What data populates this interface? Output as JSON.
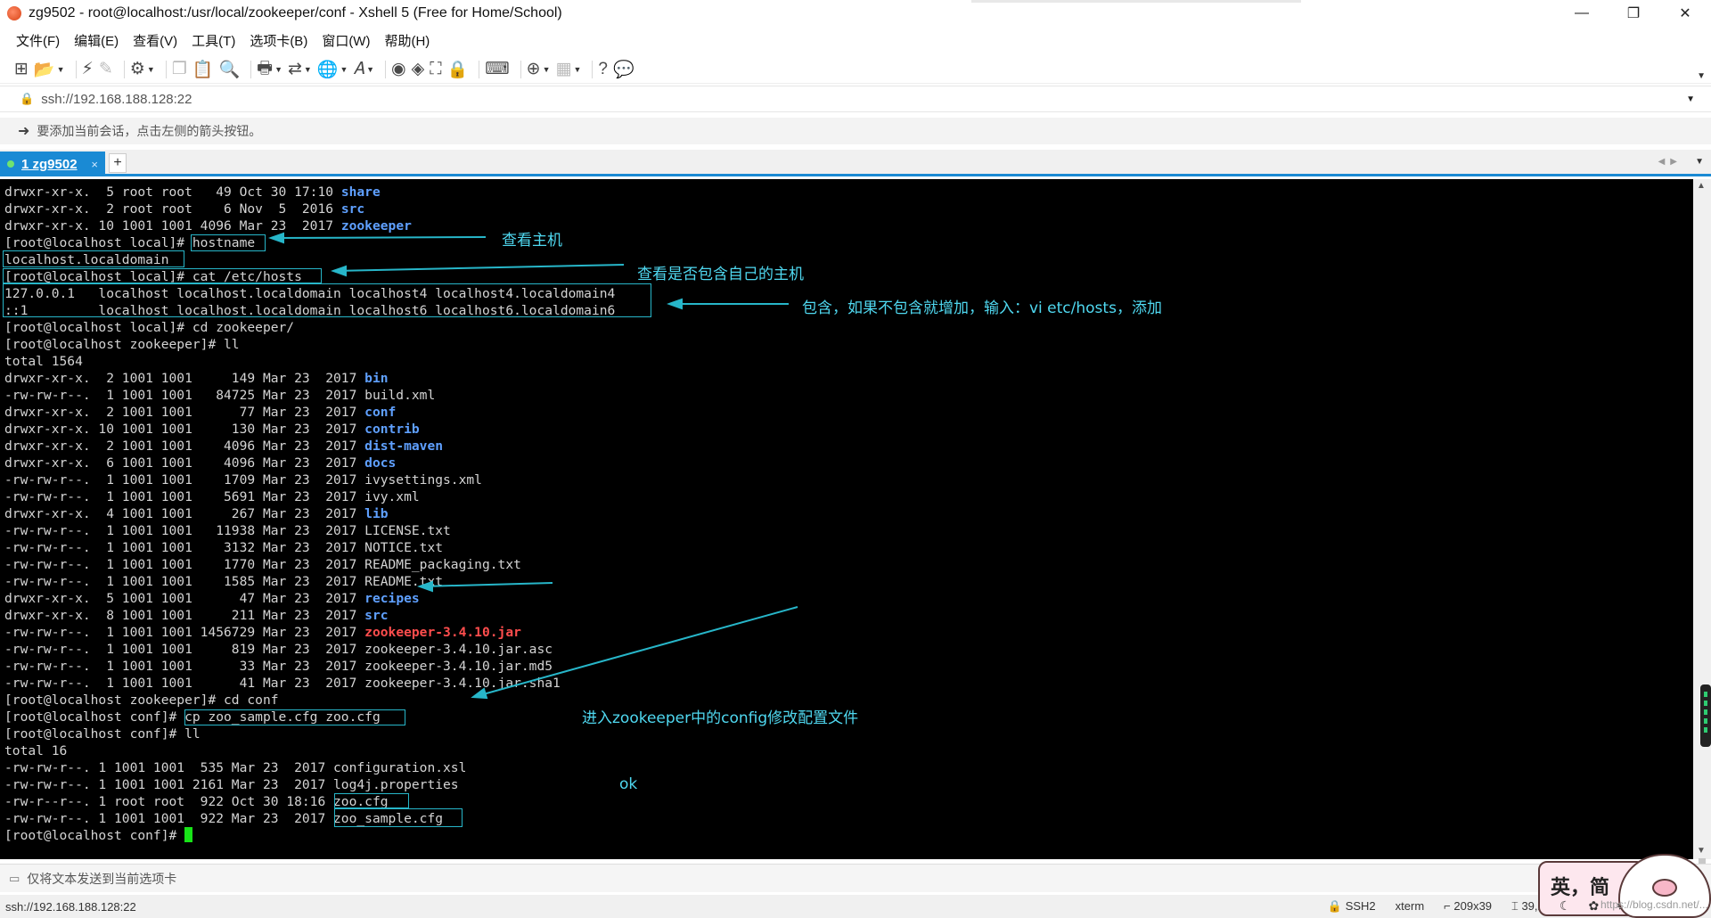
{
  "window": {
    "title": "zg9502 - root@localhost:/usr/local/zookeeper/conf - Xshell 5 (Free for Home/School)",
    "controls": [
      "—",
      "❐",
      "✕"
    ]
  },
  "menu": [
    "文件(F)",
    "编辑(E)",
    "查看(V)",
    "工具(T)",
    "选项卡(B)",
    "窗口(W)",
    "帮助(H)"
  ],
  "address": {
    "value": "ssh://192.168.188.128:22"
  },
  "hint": "要添加当前会话，点击左侧的箭头按钮。",
  "tab": {
    "label": "1 zg9502",
    "close": "×",
    "add": "+"
  },
  "terminal": {
    "lines": [
      [
        {
          "t": "drwxr-xr-x.  5 root root   49 Oct 30 17:10 "
        },
        {
          "t": "share",
          "c": "dir"
        }
      ],
      [
        {
          "t": "drwxr-xr-x.  2 root root    6 Nov  5  2016 "
        },
        {
          "t": "src",
          "c": "dir"
        }
      ],
      [
        {
          "t": "drwxr-xr-x. 10 1001 1001 4096 Mar 23  2017 "
        },
        {
          "t": "zookeeper",
          "c": "dir"
        }
      ],
      [
        {
          "t": "[root@localhost local]# hostname"
        }
      ],
      [
        {
          "t": "localhost.localdomain"
        }
      ],
      [
        {
          "t": "[root@localhost local]# cat /etc/hosts"
        }
      ],
      [
        {
          "t": "127.0.0.1   localhost localhost.localdomain localhost4 localhost4.localdomain4"
        }
      ],
      [
        {
          "t": "::1         localhost localhost.localdomain localhost6 localhost6.localdomain6"
        }
      ],
      [
        {
          "t": "[root@localhost local]# cd zookeeper/"
        }
      ],
      [
        {
          "t": "[root@localhost zookeeper]# ll"
        }
      ],
      [
        {
          "t": "total 1564"
        }
      ],
      [
        {
          "t": "drwxr-xr-x.  2 1001 1001     149 Mar 23  2017 "
        },
        {
          "t": "bin",
          "c": "dir"
        }
      ],
      [
        {
          "t": "-rw-rw-r--.  1 1001 1001   84725 Mar 23  2017 build.xml"
        }
      ],
      [
        {
          "t": "drwxr-xr-x.  2 1001 1001      77 Mar 23  2017 "
        },
        {
          "t": "conf",
          "c": "dir"
        }
      ],
      [
        {
          "t": "drwxr-xr-x. 10 1001 1001     130 Mar 23  2017 "
        },
        {
          "t": "contrib",
          "c": "dir"
        }
      ],
      [
        {
          "t": "drwxr-xr-x.  2 1001 1001    4096 Mar 23  2017 "
        },
        {
          "t": "dist-maven",
          "c": "dir"
        }
      ],
      [
        {
          "t": "drwxr-xr-x.  6 1001 1001    4096 Mar 23  2017 "
        },
        {
          "t": "docs",
          "c": "dir"
        }
      ],
      [
        {
          "t": "-rw-rw-r--.  1 1001 1001    1709 Mar 23  2017 ivysettings.xml"
        }
      ],
      [
        {
          "t": "-rw-rw-r--.  1 1001 1001    5691 Mar 23  2017 ivy.xml"
        }
      ],
      [
        {
          "t": "drwxr-xr-x.  4 1001 1001     267 Mar 23  2017 "
        },
        {
          "t": "lib",
          "c": "dir"
        }
      ],
      [
        {
          "t": "-rw-rw-r--.  1 1001 1001   11938 Mar 23  2017 LICENSE.txt"
        }
      ],
      [
        {
          "t": "-rw-rw-r--.  1 1001 1001    3132 Mar 23  2017 NOTICE.txt"
        }
      ],
      [
        {
          "t": "-rw-rw-r--.  1 1001 1001    1770 Mar 23  2017 README_packaging.txt"
        }
      ],
      [
        {
          "t": "-rw-rw-r--.  1 1001 1001    1585 Mar 23  2017 README.txt"
        }
      ],
      [
        {
          "t": "drwxr-xr-x.  5 1001 1001      47 Mar 23  2017 "
        },
        {
          "t": "recipes",
          "c": "dir"
        }
      ],
      [
        {
          "t": "drwxr-xr-x.  8 1001 1001     211 Mar 23  2017 "
        },
        {
          "t": "src",
          "c": "dir"
        }
      ],
      [
        {
          "t": "-rw-rw-r--.  1 1001 1001 1456729 Mar 23  2017 "
        },
        {
          "t": "zookeeper-3.4.10.jar",
          "c": "jar"
        }
      ],
      [
        {
          "t": "-rw-rw-r--.  1 1001 1001     819 Mar 23  2017 zookeeper-3.4.10.jar.asc"
        }
      ],
      [
        {
          "t": "-rw-rw-r--.  1 1001 1001      33 Mar 23  2017 zookeeper-3.4.10.jar.md5"
        }
      ],
      [
        {
          "t": "-rw-rw-r--.  1 1001 1001      41 Mar 23  2017 zookeeper-3.4.10.jar.sha1"
        }
      ],
      [
        {
          "t": "[root@localhost zookeeper]# cd conf"
        }
      ],
      [
        {
          "t": "[root@localhost conf]# cp zoo_sample.cfg zoo.cfg"
        }
      ],
      [
        {
          "t": "[root@localhost conf]# ll"
        }
      ],
      [
        {
          "t": "total 16"
        }
      ],
      [
        {
          "t": "-rw-rw-r--. 1 1001 1001  535 Mar 23  2017 configuration.xsl"
        }
      ],
      [
        {
          "t": "-rw-rw-r--. 1 1001 1001 2161 Mar 23  2017 log4j.properties"
        }
      ],
      [
        {
          "t": "-rw-r--r--. 1 root root  922 Oct 30 18:16 zoo.cfg"
        }
      ],
      [
        {
          "t": "-rw-rw-r--. 1 1001 1001  922 Mar 23  2017 zoo_sample.cfg"
        }
      ],
      [
        {
          "t": "[root@localhost conf]# "
        }
      ]
    ]
  },
  "annotations": {
    "a1": "查看主机",
    "a2": "查看是否包含自己的主机",
    "a3": "包含，如果不包含就增加，输入：vi etc/hosts，添加",
    "a4": "进入zookeeper中的config修改配置文件",
    "a5": "ok"
  },
  "sendbar": "仅将文本发送到当前选项卡",
  "status": {
    "left": "ssh://192.168.188.128:22",
    "protocol": "SSH2",
    "term": "xterm",
    "size": "209x39",
    "pos": "39,24"
  },
  "ime": {
    "t1": "英，简",
    "t2": "☾ ✿ ⚙",
    "wm": "https://blog.csdn.net/..."
  },
  "colors": {
    "accent": "#1a8ad4",
    "annotation": "#4fd8f0",
    "dir": "#5fa0ff",
    "jar": "#ff4d4d",
    "cursor": "#18e318"
  }
}
